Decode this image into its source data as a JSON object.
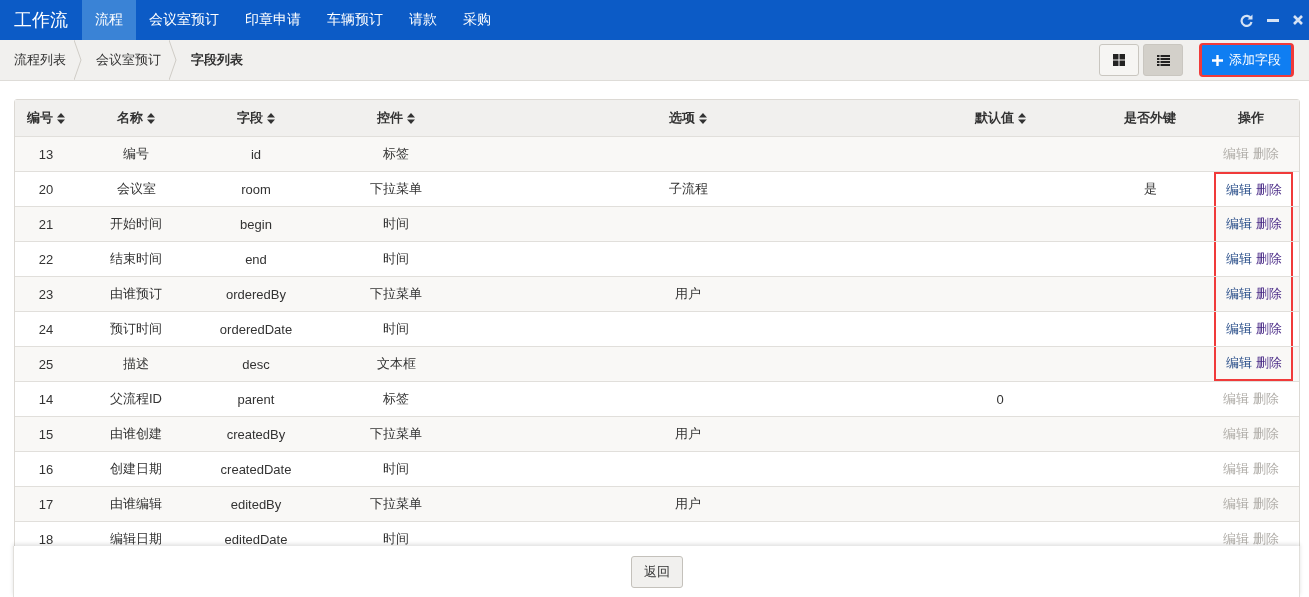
{
  "app_title": "工作流",
  "nav": [
    {
      "label": "流程",
      "selected": true
    },
    {
      "label": "会议室预订",
      "selected": false
    },
    {
      "label": "印章申请",
      "selected": false
    },
    {
      "label": "车辆预订",
      "selected": false
    },
    {
      "label": "请款",
      "selected": false
    },
    {
      "label": "采购",
      "selected": false
    }
  ],
  "breadcrumb": [
    {
      "label": "流程列表",
      "current": false
    },
    {
      "label": "会议室预订",
      "current": false
    },
    {
      "label": "字段列表",
      "current": true
    }
  ],
  "view_toggle": [
    {
      "kind": "grid",
      "selected": false
    },
    {
      "kind": "list",
      "selected": true
    }
  ],
  "add_button": {
    "label": "添加字段",
    "highlighted": true
  },
  "table": {
    "columns": [
      {
        "label": "编号",
        "sortable": true
      },
      {
        "label": "名称",
        "sortable": true
      },
      {
        "label": "字段",
        "sortable": true
      },
      {
        "label": "控件",
        "sortable": true
      },
      {
        "label": "选项",
        "sortable": true
      },
      {
        "label": "默认值",
        "sortable": true
      },
      {
        "label": "是否外键",
        "sortable": false
      },
      {
        "label": "操作",
        "sortable": false
      }
    ],
    "rows": [
      {
        "cells": [
          "13",
          "编号",
          "id",
          "标签",
          "",
          "",
          "",
          ""
        ],
        "actions": [
          "编辑",
          "删除"
        ],
        "enabled": false,
        "highlighted": false
      },
      {
        "cells": [
          "20",
          "会议室",
          "room",
          "下拉菜单",
          "子流程",
          "",
          "是"
        ],
        "actions": [
          "编辑",
          "删除"
        ],
        "enabled": true,
        "highlighted": true
      },
      {
        "cells": [
          "21",
          "开始时间",
          "begin",
          "时间",
          "",
          "",
          ""
        ],
        "actions": [
          "编辑",
          "删除"
        ],
        "enabled": true,
        "highlighted": true
      },
      {
        "cells": [
          "22",
          "结束时间",
          "end",
          "时间",
          "",
          "",
          ""
        ],
        "actions": [
          "编辑",
          "删除"
        ],
        "enabled": true,
        "highlighted": true
      },
      {
        "cells": [
          "23",
          "由谁预订",
          "orderedBy",
          "下拉菜单",
          "用户",
          "",
          ""
        ],
        "actions": [
          "编辑",
          "删除"
        ],
        "enabled": true,
        "highlighted": true
      },
      {
        "cells": [
          "24",
          "预订时间",
          "orderedDate",
          "时间",
          "",
          "",
          ""
        ],
        "actions": [
          "编辑",
          "删除"
        ],
        "enabled": true,
        "highlighted": true
      },
      {
        "cells": [
          "25",
          "描述",
          "desc",
          "文本框",
          "",
          "",
          ""
        ],
        "actions": [
          "编辑",
          "删除"
        ],
        "enabled": true,
        "highlighted": true
      },
      {
        "cells": [
          "14",
          "父流程ID",
          "parent",
          "标签",
          "",
          "0",
          ""
        ],
        "actions": [
          "编辑",
          "删除"
        ],
        "enabled": false,
        "highlighted": false
      },
      {
        "cells": [
          "15",
          "由谁创建",
          "createdBy",
          "下拉菜单",
          "用户",
          "",
          ""
        ],
        "actions": [
          "编辑",
          "删除"
        ],
        "enabled": false,
        "highlighted": false
      },
      {
        "cells": [
          "16",
          "创建日期",
          "createdDate",
          "时间",
          "",
          "",
          ""
        ],
        "actions": [
          "编辑",
          "删除"
        ],
        "enabled": false,
        "highlighted": false
      },
      {
        "cells": [
          "17",
          "由谁编辑",
          "editedBy",
          "下拉菜单",
          "用户",
          "",
          ""
        ],
        "actions": [
          "编辑",
          "删除"
        ],
        "enabled": false,
        "highlighted": false
      },
      {
        "cells": [
          "18",
          "编辑日期",
          "editedDate",
          "时间",
          "",
          "",
          ""
        ],
        "actions": [
          "编辑",
          "删除"
        ],
        "enabled": false,
        "highlighted": false
      }
    ]
  },
  "back_button": "返回"
}
